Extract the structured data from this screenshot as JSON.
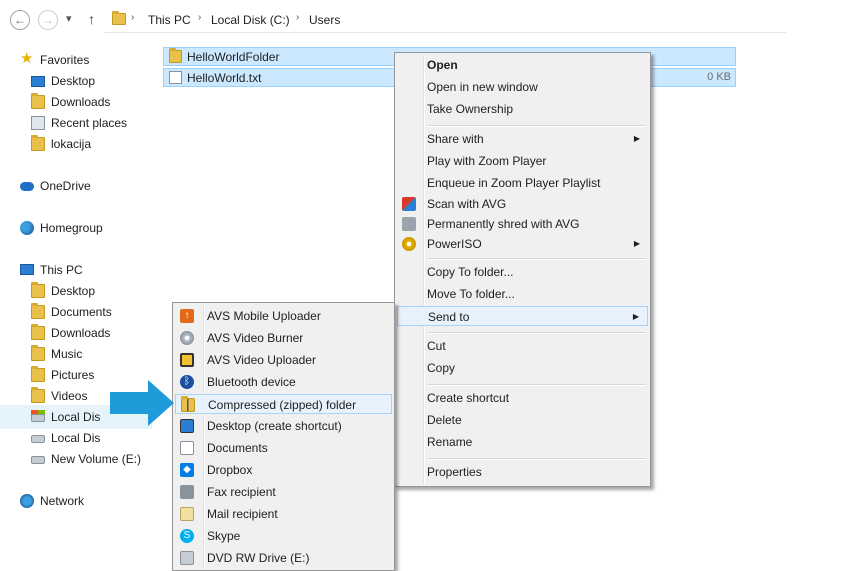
{
  "toolbar": {
    "back": "←",
    "forward": "→",
    "dropdown": "▾",
    "up": "↑"
  },
  "breadcrumb": [
    "This PC",
    "Local Disk (C:)",
    "Users"
  ],
  "nav": {
    "favorites": "Favorites",
    "fav_items": [
      "Desktop",
      "Downloads",
      "Recent places",
      "lokacija"
    ],
    "onedrive": "OneDrive",
    "homegroup": "Homegroup",
    "thispc": "This PC",
    "pc_items": [
      "Desktop",
      "Documents",
      "Downloads",
      "Music",
      "Pictures",
      "Videos",
      "Local Dis",
      "Local Dis",
      "New Volume (E:)"
    ],
    "network": "Network"
  },
  "files": [
    {
      "name": "HelloWorldFolder",
      "size": ""
    },
    {
      "name": "HelloWorld.txt",
      "size": "0 KB"
    }
  ],
  "context_menu": {
    "open": "Open",
    "open_new_window": "Open in new window",
    "take_ownership": "Take Ownership",
    "share_with": "Share with",
    "play_zoom": "Play with Zoom Player",
    "enqueue_zoom": "Enqueue in Zoom Player Playlist",
    "scan_avg": "Scan with AVG",
    "shred_avg": "Permanently shred with AVG",
    "poweriso": "PowerISO",
    "copy_to": "Copy To folder...",
    "move_to": "Move To folder...",
    "send_to": "Send to",
    "cut": "Cut",
    "copy": "Copy",
    "create_shortcut": "Create shortcut",
    "delete": "Delete",
    "rename": "Rename",
    "properties": "Properties"
  },
  "send_to_menu": [
    {
      "label": "AVS Mobile Uploader",
      "icon": "upload-arrow-icon"
    },
    {
      "label": "AVS Video Burner",
      "icon": "disc-burn-icon"
    },
    {
      "label": "AVS Video Uploader",
      "icon": "film-upload-icon"
    },
    {
      "label": "Bluetooth device",
      "icon": "bluetooth-icon"
    },
    {
      "label": "Compressed (zipped) folder",
      "icon": "zip-folder-icon"
    },
    {
      "label": "Desktop (create shortcut)",
      "icon": "desktop-icon"
    },
    {
      "label": "Documents",
      "icon": "documents-icon"
    },
    {
      "label": "Dropbox",
      "icon": "dropbox-icon"
    },
    {
      "label": "Fax recipient",
      "icon": "fax-icon"
    },
    {
      "label": "Mail recipient",
      "icon": "mail-icon"
    },
    {
      "label": "Skype",
      "icon": "skype-icon"
    },
    {
      "label": "DVD RW Drive (E:)",
      "icon": "dvd-drive-icon"
    }
  ],
  "colors": {
    "selection": "#cce8ff",
    "accent_arrow": "#1e9bd8",
    "menu_bg": "#f0f0f0"
  }
}
